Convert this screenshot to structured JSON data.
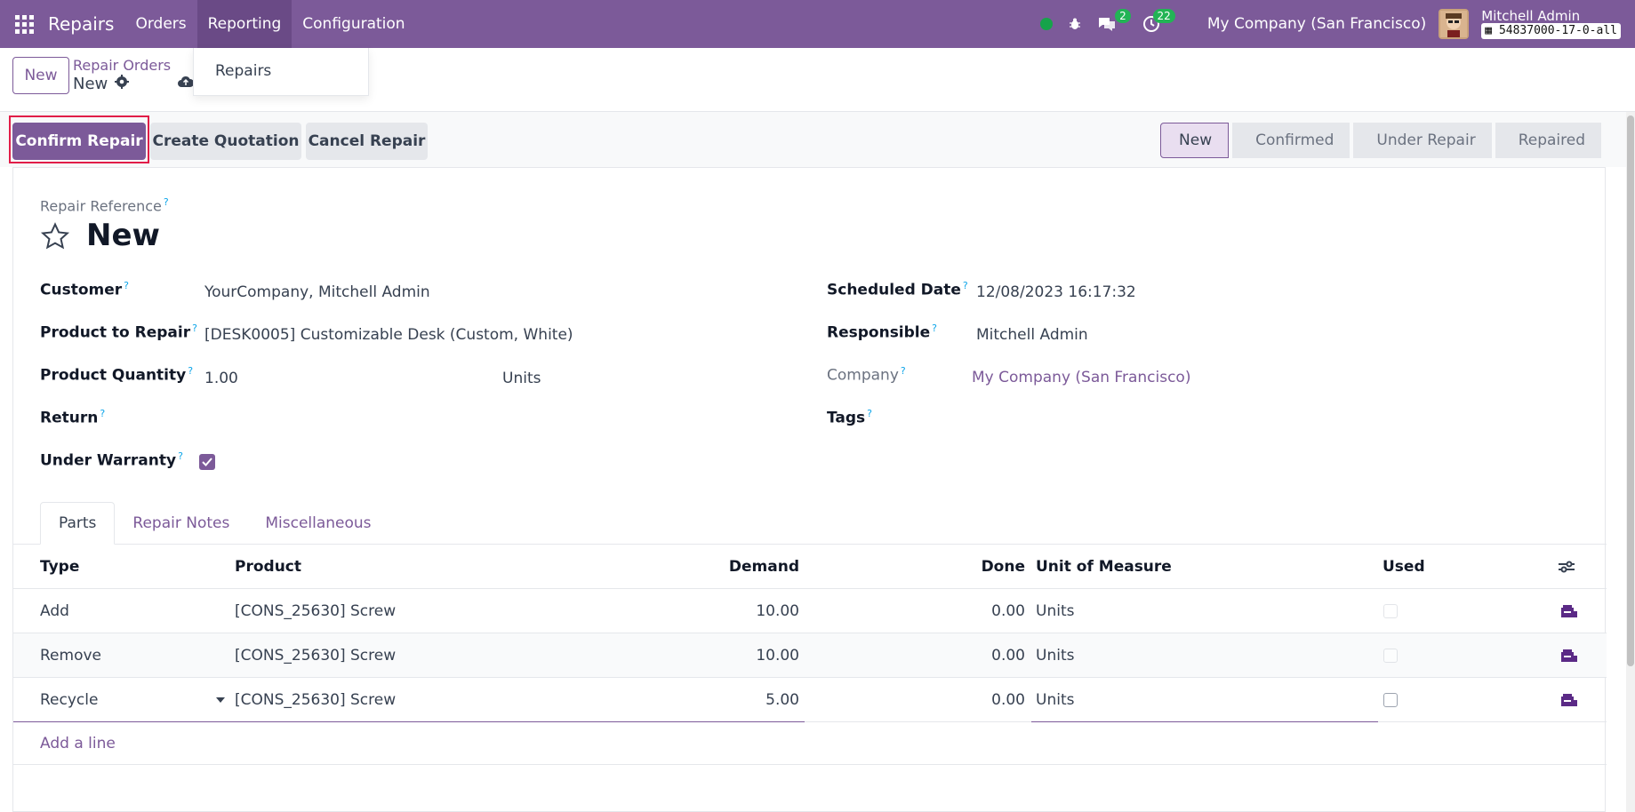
{
  "navbar": {
    "brand": "Repairs",
    "menu": [
      {
        "label": "Orders"
      },
      {
        "label": "Reporting"
      },
      {
        "label": "Configuration"
      }
    ],
    "chat_badge": "2",
    "activity_badge": "22",
    "company": "My Company (San Francisco)",
    "user_name": "Mitchell Admin",
    "db_name": "54837000-17-0-all"
  },
  "dropdown": {
    "item": "Repairs"
  },
  "control": {
    "new_label": "New",
    "breadcrumb": "Repair Orders",
    "record": "New"
  },
  "actions": {
    "confirm": "Confirm Repair",
    "quotation": "Create Quotation",
    "cancel": "Cancel Repair"
  },
  "statusbar": [
    "New",
    "Confirmed",
    "Under Repair",
    "Repaired"
  ],
  "form": {
    "ref_label": "Repair Reference",
    "ref_value": "New",
    "customer_label": "Customer",
    "customer_value": "YourCompany, Mitchell Admin",
    "product_label": "Product to Repair",
    "product_value": "[DESK0005] Customizable Desk (Custom, White)",
    "qty_label": "Product Quantity",
    "qty_value": "1.00",
    "qty_uom": "Units",
    "return_label": "Return",
    "warranty_label": "Under Warranty",
    "warranty_checked": true,
    "scheduled_label": "Scheduled Date",
    "scheduled_value": "12/08/2023 16:17:32",
    "responsible_label": "Responsible",
    "responsible_value": "Mitchell Admin",
    "company_label": "Company",
    "company_value": "My Company (San Francisco)",
    "tags_label": "Tags"
  },
  "tabs": [
    "Parts",
    "Repair Notes",
    "Miscellaneous"
  ],
  "parts_table": {
    "headers": {
      "type": "Type",
      "product": "Product",
      "demand": "Demand",
      "done": "Done",
      "uom": "Unit of Measure",
      "used": "Used"
    },
    "rows": [
      {
        "type": "Add",
        "product": "[CONS_25630] Screw",
        "demand": "10.00",
        "done": "0.00",
        "uom": "Units",
        "used": false
      },
      {
        "type": "Remove",
        "product": "[CONS_25630] Screw",
        "demand": "10.00",
        "done": "0.00",
        "uom": "Units",
        "used": false
      },
      {
        "type": "Recycle",
        "product": "[CONS_25630] Screw",
        "demand": "5.00",
        "done": "0.00",
        "uom": "Units",
        "used": false
      }
    ],
    "add_line": "Add a line"
  },
  "colors": {
    "brand": "#7c5a99",
    "highlight": "#e11d48",
    "badge": "#22b455"
  }
}
